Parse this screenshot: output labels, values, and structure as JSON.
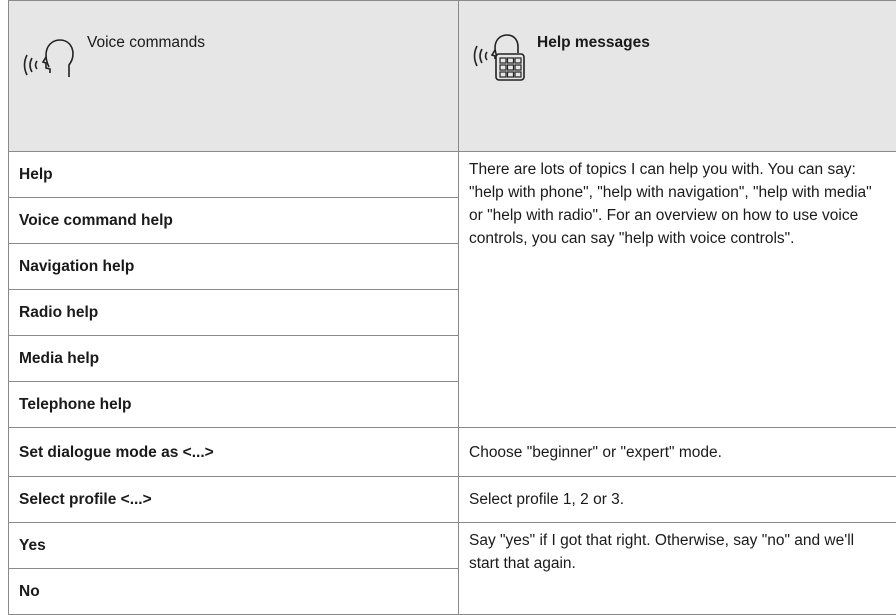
{
  "header": {
    "col1_label": "Voice commands",
    "col1_icon": "voice-head-icon",
    "col2_label": "Help messages",
    "col2_icon": "voice-screen-icon"
  },
  "rows": {
    "help_group": {
      "commands": [
        "Help",
        "Voice command help",
        "Navigation help",
        "Radio help",
        "Media help",
        "Telephone help"
      ],
      "message": "There are lots of topics I can help you with. You can say: \"help with phone\", \"help with navigation\", \"help with media\" or \"help with radio\". For an overview on how to use voice controls, you can say \"help with voice controls\"."
    },
    "dialogue": {
      "command": "Set dialogue mode as <...>",
      "message": "Choose \"beginner\" or \"expert\" mode."
    },
    "profile": {
      "command": "Select profile <...>",
      "message": "Select profile 1, 2 or 3."
    },
    "confirm_group": {
      "commands": [
        "Yes",
        "No"
      ],
      "message": "Say \"yes\" if I got that right. Otherwise, say \"no\" and we'll start that again."
    }
  }
}
